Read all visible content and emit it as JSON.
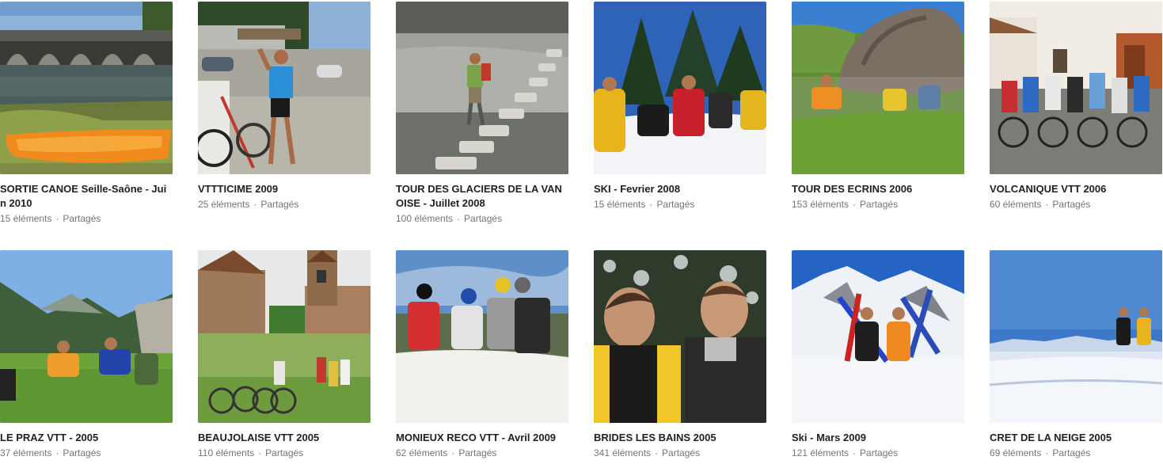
{
  "shared_label": "Partagés",
  "dot": "·",
  "albums": [
    {
      "title": "SORTIE CANOE Seille-Saône - Juin 2010",
      "count": "15 éléments",
      "thumb": "canoe-river-bridge"
    },
    {
      "title": "VTTTICIME 2009",
      "count": "25 éléments",
      "thumb": "cyclist-parking-lot"
    },
    {
      "title": "TOUR DES GLACIERS DE LA VANOISE - Juillet 2008",
      "count": "100 éléments",
      "thumb": "hiker-stone-path"
    },
    {
      "title": "SKI - Fevrier 2008",
      "count": "15 éléments",
      "thumb": "skiers-snow-trees"
    },
    {
      "title": "TOUR DES ECRINS 2006",
      "count": "153 éléments",
      "thumb": "hikers-boulder-meadow"
    },
    {
      "title": "VOLCANIQUE VTT 2006",
      "count": "60 éléments",
      "thumb": "cyclists-village-house"
    },
    {
      "title": "LE PRAZ VTT - 2005",
      "count": "37 éléments",
      "thumb": "cyclists-mountain-meadow"
    },
    {
      "title": "BEAUJOLAISE VTT 2005",
      "count": "110 éléments",
      "thumb": "bikes-church-village"
    },
    {
      "title": "MONIEUX RECO VTT - Avril 2009",
      "count": "62 éléments",
      "thumb": "cyclists-helmets-sky"
    },
    {
      "title": "BRIDES LES BAINS 2005",
      "count": "341 éléments",
      "thumb": "skiers-portrait-forest"
    },
    {
      "title": "Ski - Mars 2009",
      "count": "121 éléments",
      "thumb": "skiers-crossed-skis-peak"
    },
    {
      "title": "CRET DE LA NEIGE 2005",
      "count": "69 éléments",
      "thumb": "skiers-snowy-ridge"
    }
  ]
}
